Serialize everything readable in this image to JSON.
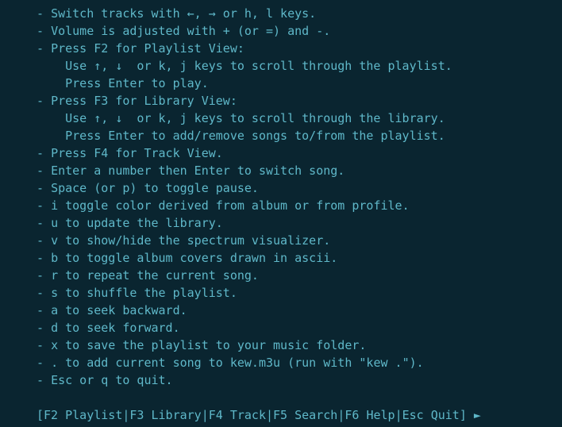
{
  "help": {
    "lines": [
      {
        "bullet": "- ",
        "text": "Switch tracks with ←, → or h, l keys."
      },
      {
        "bullet": "- ",
        "text": "Volume is adjusted with + (or =) and -."
      },
      {
        "bullet": "- ",
        "text": "Press F2 for Playlist View:",
        "sub": [
          "Use ↑, ↓  or k, j keys to scroll through the playlist.",
          "Press Enter to play."
        ]
      },
      {
        "bullet": "- ",
        "text": "Press F3 for Library View:",
        "sub": [
          "Use ↑, ↓  or k, j keys to scroll through the library.",
          "Press Enter to add/remove songs to/from the playlist."
        ]
      },
      {
        "bullet": "- ",
        "text": "Press F4 for Track View."
      },
      {
        "bullet": "- ",
        "text": "Enter a number then Enter to switch song."
      },
      {
        "bullet": "- ",
        "text": "Space (or p) to toggle pause."
      },
      {
        "bullet": "- ",
        "text": "i toggle color derived from album or from profile."
      },
      {
        "bullet": "- ",
        "text": "u to update the library."
      },
      {
        "bullet": "- ",
        "text": "v to show/hide the spectrum visualizer."
      },
      {
        "bullet": "- ",
        "text": "b to toggle album covers drawn in ascii."
      },
      {
        "bullet": "- ",
        "text": "r to repeat the current song."
      },
      {
        "bullet": "- ",
        "text": "s to shuffle the playlist."
      },
      {
        "bullet": "- ",
        "text": "a to seek backward."
      },
      {
        "bullet": "- ",
        "text": "d to seek forward."
      },
      {
        "bullet": "- ",
        "text": "x to save the playlist to your music folder."
      },
      {
        "bullet": "- ",
        "text": ". to add current song to kew.m3u (run with \"kew .\")."
      },
      {
        "bullet": "- ",
        "text": "Esc or q to quit."
      }
    ]
  },
  "status_bar": {
    "open": "[",
    "close": "]",
    "sep": "|",
    "items": [
      {
        "key": "F2",
        "label": "Playlist"
      },
      {
        "key": "F3",
        "label": "Library"
      },
      {
        "key": "F4",
        "label": "Track"
      },
      {
        "key": "F5",
        "label": "Search"
      },
      {
        "key": "F6",
        "label": "Help"
      },
      {
        "key": "Esc",
        "label": "Quit"
      }
    ],
    "play_icon": "►"
  }
}
